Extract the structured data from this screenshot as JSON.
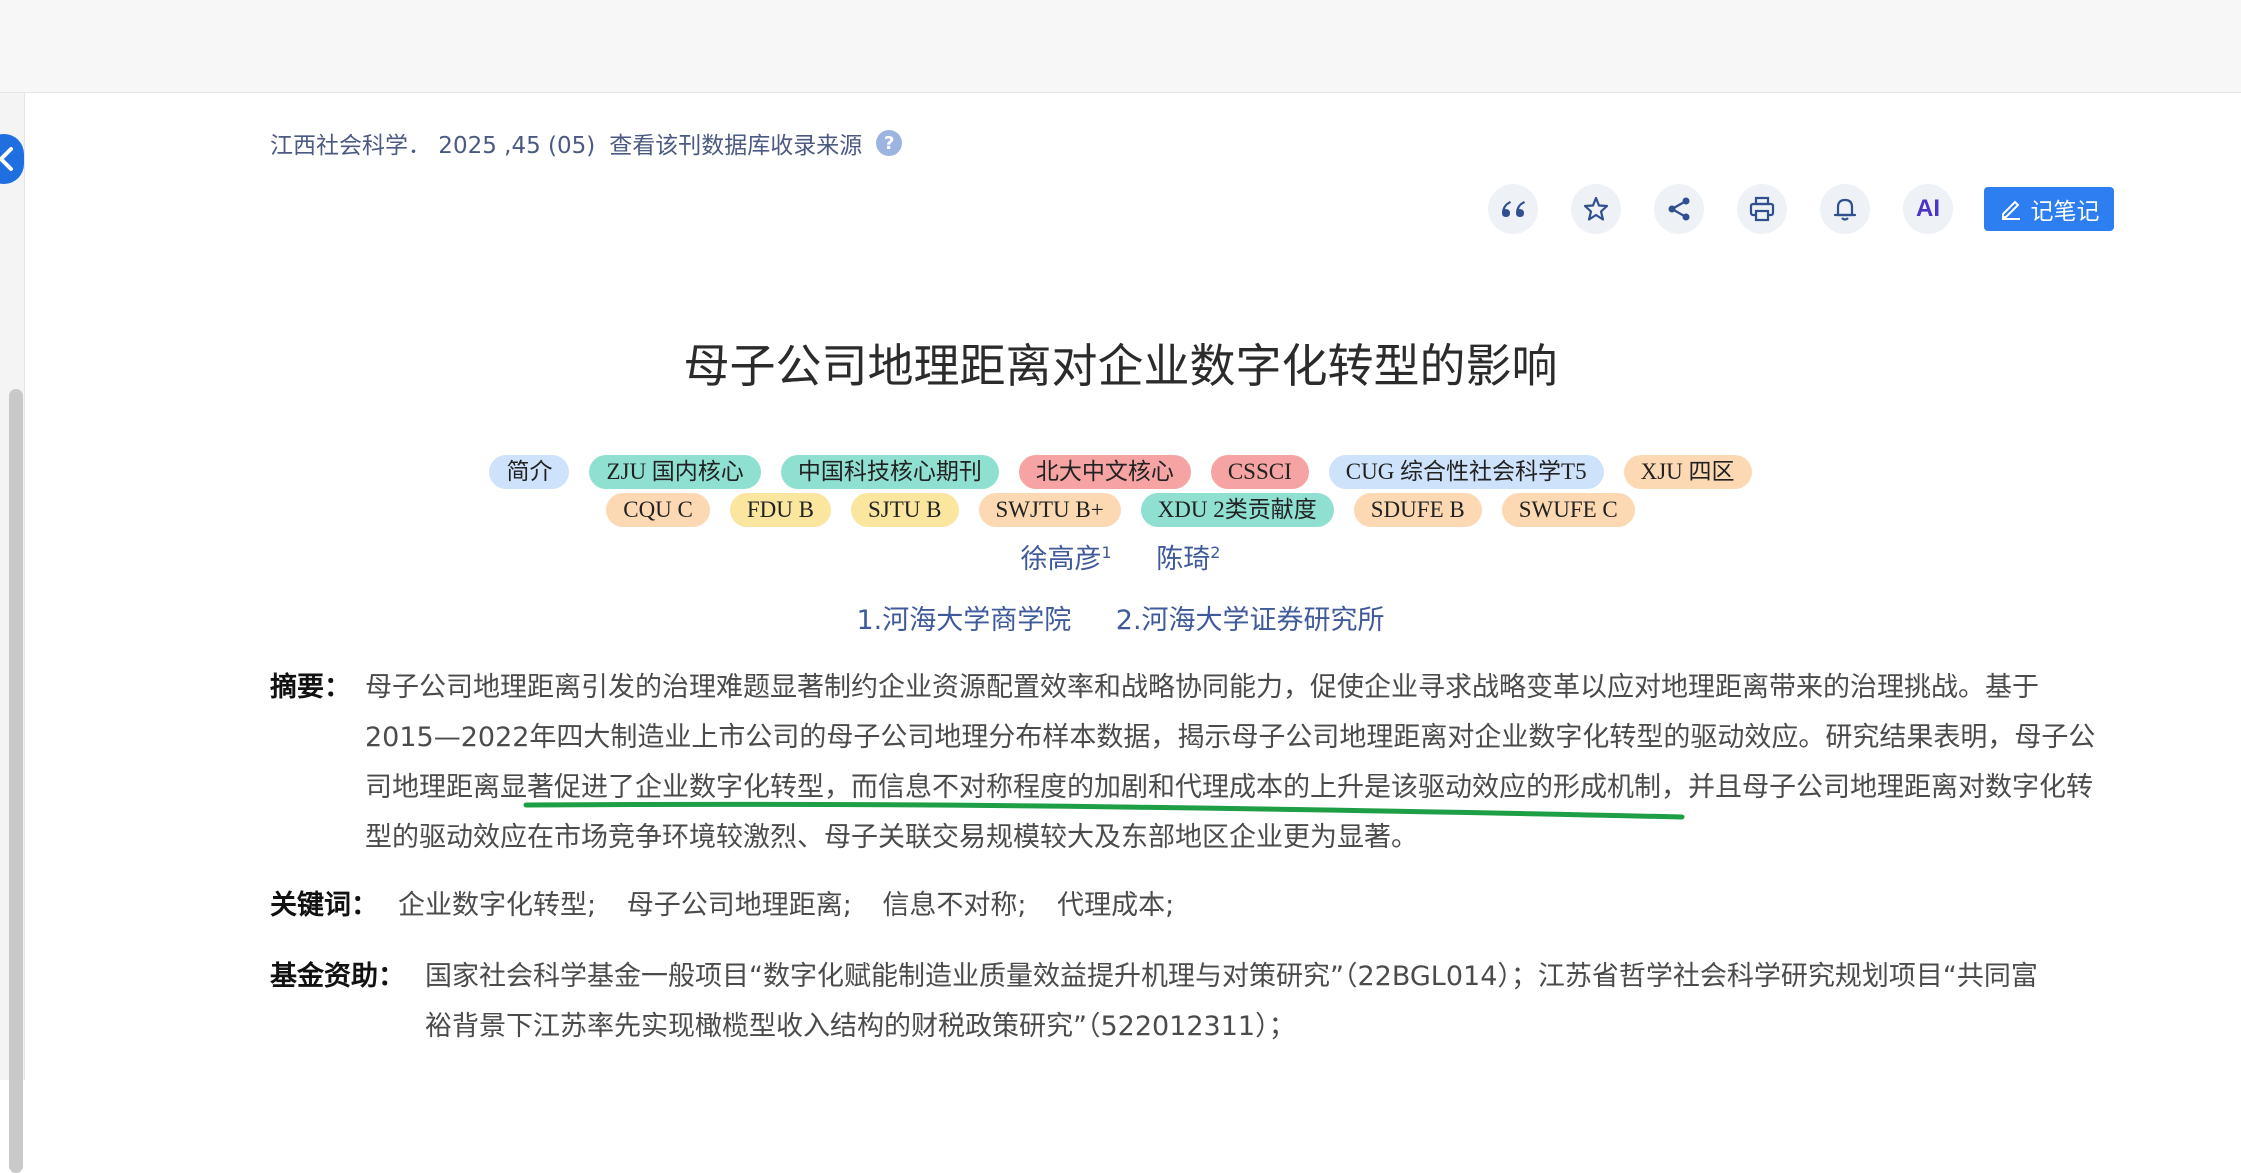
{
  "source": {
    "journal_info": "江西社会科学．  2025 ,45 (05)",
    "db_link": "查看该刊数据库收录来源",
    "help_symbol": "?"
  },
  "toolbar": {
    "ai_label": "AI",
    "note_label": "记笔记",
    "accent": "#2d7ef0"
  },
  "article": {
    "title": "母子公司地理距离对企业数字化转型的影响"
  },
  "tags_row1": [
    {
      "label": "简介",
      "bg": "#cfe2fb"
    },
    {
      "label": "ZJU 国内核心",
      "bg": "#8fe0d0"
    },
    {
      "label": "中国科技核心期刊",
      "bg": "#8fe0d0"
    },
    {
      "label": "北大中文核心",
      "bg": "#f5a3a3"
    },
    {
      "label": "CSSCI",
      "bg": "#f5a3a3"
    },
    {
      "label": "CUG 综合性社会科学T5",
      "bg": "#cfe2fb"
    },
    {
      "label": "XJU 四区",
      "bg": "#fcd9b3"
    }
  ],
  "tags_row2": [
    {
      "label": "CQU C",
      "bg": "#fcd9b3"
    },
    {
      "label": "FDU B",
      "bg": "#fbe6a0"
    },
    {
      "label": "SJTU B",
      "bg": "#fbe6a0"
    },
    {
      "label": "SWJTU B+",
      "bg": "#fcd9b3"
    },
    {
      "label": "XDU 2类贡献度",
      "bg": "#8fe0d0"
    },
    {
      "label": "SDUFE B",
      "bg": "#fcd9b3"
    },
    {
      "label": "SWUFE C",
      "bg": "#fcd9b3"
    }
  ],
  "authors": [
    {
      "name": "徐高彦",
      "sup": "1"
    },
    {
      "name": "陈琦",
      "sup": "2"
    }
  ],
  "affiliations": [
    "1.河海大学商学院",
    "2.河海大学证券研究所"
  ],
  "abstract": {
    "label": "摘要：",
    "lines": [
      "母子公司地理距离引发的治理难题显著制约企业资源配置效率和战略协同能力，促使企业寻求战略变革以应对地理距离带来的治理挑战。基于",
      "2015—2022年四大制造业上市公司的母子公司地理分布样本数据，揭示母子公司地理距离对企业数字化转型的驱动效应。研究结果表明，母子公",
      "司地理距离显著促进了企业数字化转型，而信息不对称程度的加剧和代理成本的上升是该驱动效应的形成机制，并且母子公司地理距离对数字化转",
      "型的驱动效应在市场竞争环境较激烈、母子关联交易规模较大及东部地区企业更为显著。"
    ]
  },
  "keywords": {
    "label": "关键词：",
    "items": [
      "企业数字化转型;",
      "母子公司地理距离;",
      "信息不对称;",
      "代理成本;"
    ]
  },
  "funding": {
    "label": "基金资助：",
    "lines": [
      "国家社会科学基金一般项目“数字化赋能制造业质量效益提升机理与对策研究”（22BGL014）；江苏省哲学社会科学研究规划项目“共同富",
      "裕背景下江苏率先实现橄榄型收入结构的财税政策研究”（522012311）；"
    ]
  }
}
